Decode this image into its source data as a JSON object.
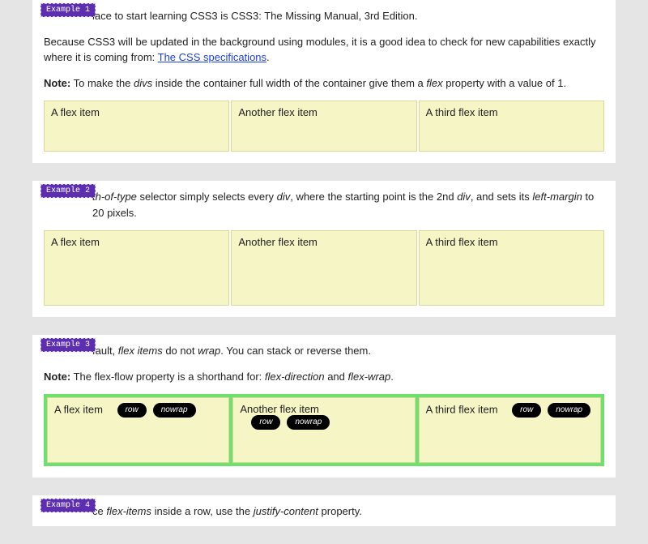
{
  "badges": {
    "ex1": "Example 1",
    "ex2": "Example 2",
    "ex3": "Example 3",
    "ex4": "Example 4"
  },
  "ex1": {
    "p1_tail": "lace to start learning CSS3 is CSS3: The Missing Manual, 3rd Edition.",
    "p2_a": "Because CSS3 will be updated in the background using modules, it is a good idea to check for new capabilities exactly where it is coming from: ",
    "p2_link": "The CSS specifications",
    "p2_period": ".",
    "p3_note": "Note:",
    "p3_a": " To make the ",
    "p3_i1": "divs",
    "p3_b": " inside the container full width of the container give them a ",
    "p3_i2": "flex",
    "p3_c": " property with a value of 1."
  },
  "ex2": {
    "p1_i1": "th-of-type",
    "p1_a": " selector simply selects every ",
    "p1_i2": "div",
    "p1_b": ", where the starting point is the 2nd ",
    "p1_i3": "div",
    "p1_c": ", and sets its ",
    "p1_i4": "left-margin",
    "p1_d": " to 20 pixels."
  },
  "ex3": {
    "p1_a": "fault, ",
    "p1_i1": "flex items",
    "p1_b": " do not ",
    "p1_i2": "wrap",
    "p1_c": ". You can stack or reverse them.",
    "p2_note": "Note:",
    "p2_a": " The flex-flow property is a shorthand for: ",
    "p2_i1": "flex-direction",
    "p2_b": " and ",
    "p2_i2": "flex-wrap",
    "p2_c": "."
  },
  "ex4": {
    "p1_a": "ce ",
    "p1_i1": "flex-items",
    "p1_b": " inside a row, use the ",
    "p1_i2": "justify-content",
    "p1_c": " property."
  },
  "flex": {
    "a": "A flex item",
    "b": "Another flex item",
    "c": "A third flex item"
  },
  "pills": {
    "row": "row",
    "nowrap": "nowrap"
  }
}
